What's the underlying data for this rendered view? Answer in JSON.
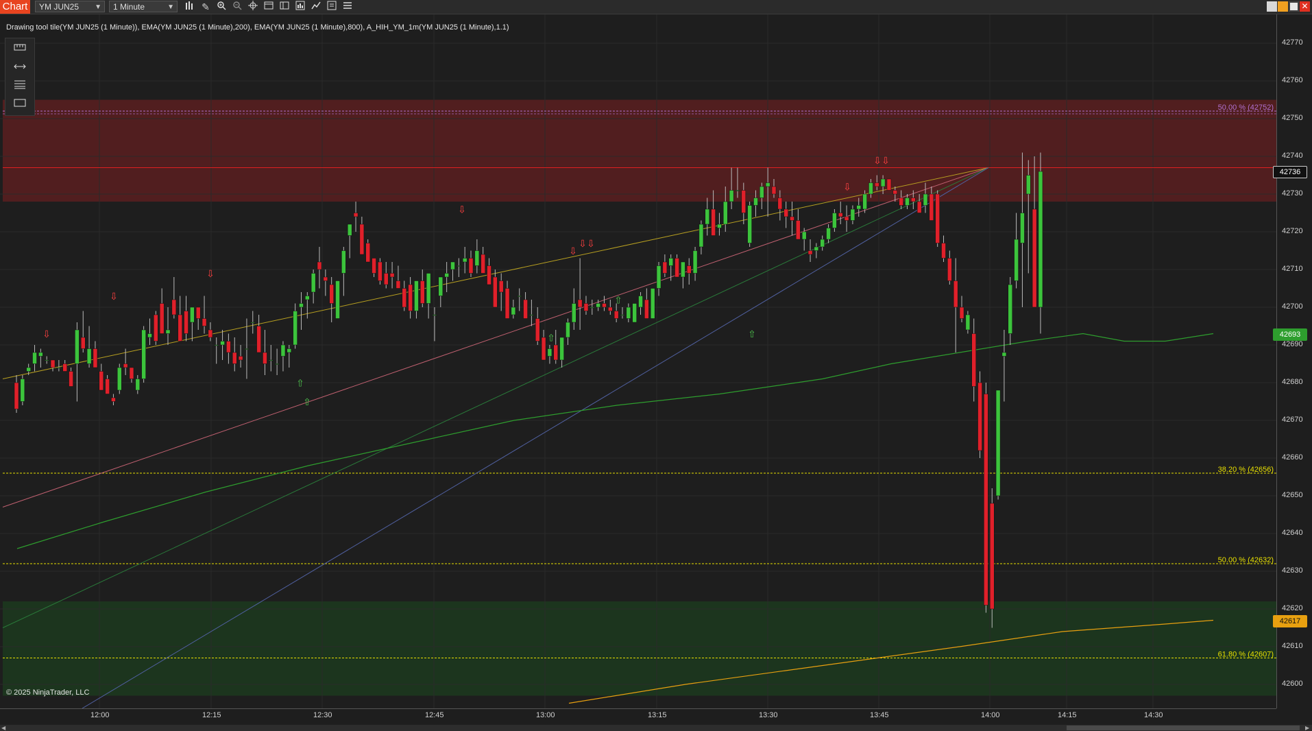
{
  "toolbar": {
    "chart_tab": "Chart",
    "instrument": "YM JUN25",
    "interval": "1 Minute",
    "icons": [
      "bars-icon",
      "pencil-icon",
      "zoom-in-icon",
      "zoom-out-icon",
      "crosshair-icon",
      "templates-icon",
      "chart-trader-icon",
      "data-box-icon",
      "strategy-icon",
      "properties-icon"
    ]
  },
  "window_controls": [
    "tile-icon",
    "minimize-icon",
    "maximize-icon",
    "close-icon"
  ],
  "indicator_label": "Drawing tool tile(YM JUN25 (1 Minute)), EMA(YM JUN25 (1 Minute),200), EMA(YM JUN25 (1 Minute),800), A_HIH_YM_1m(YM JUN25 (1 Minute),1.1)",
  "drawing_tools": [
    "ruler-icon",
    "horizontal-ray-icon",
    "lines-icon",
    "rectangle-icon"
  ],
  "copyright": "© 2025 NinjaTrader, LLC",
  "chart_data": {
    "type": "candlestick",
    "instrument": "YM JUN25",
    "interval": "1 Minute",
    "ylim": [
      42595,
      42775
    ],
    "y_ticks": [
      42770,
      42760,
      42750,
      42740,
      42730,
      42720,
      42710,
      42700,
      42690,
      42680,
      42670,
      42660,
      42650,
      42640,
      42630,
      42620,
      42610,
      42600
    ],
    "x_tick_labels": [
      "12:00",
      "12:15",
      "12:30",
      "12:45",
      "13:00",
      "13:15",
      "13:30",
      "13:45",
      "14:00",
      "14:15",
      "14:30"
    ],
    "price_markers": [
      {
        "value": "42736",
        "style": "current"
      },
      {
        "value": "42693",
        "style": "ema"
      },
      {
        "value": "42617",
        "style": "ema-orange"
      }
    ],
    "fib_levels": [
      {
        "label": "50.00 % (42752)",
        "value": 42752,
        "color": "#b070d0"
      },
      {
        "label": "38.20 % (42656)",
        "value": 42656,
        "color": "#e8e000"
      },
      {
        "label": "50.00 % (42632)",
        "value": 42632,
        "color": "#e8e000"
      },
      {
        "label": "61.80 % (42607)",
        "value": 42607,
        "color": "#e8e000"
      }
    ],
    "zones": [
      {
        "from": 42728,
        "to": 42755,
        "color": "#5a1e20"
      },
      {
        "from": 42597,
        "to": 42622,
        "color": "#1c3a1e"
      }
    ],
    "resistance_line": 42737,
    "colors": {
      "up": "#3cc43c",
      "down": "#e0202a",
      "ema200": "#2e9e2e",
      "ema800": "#e8a010"
    }
  }
}
